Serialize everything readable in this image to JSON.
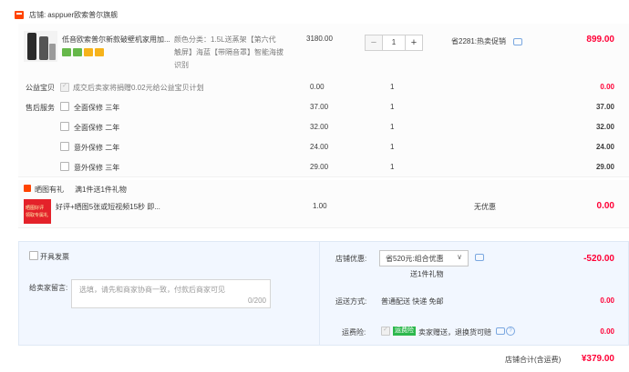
{
  "store": {
    "label": "店铺:",
    "name": "asppuer欧索普尔旗舰"
  },
  "product": {
    "title": "低音欧索普尔新款破壁机家用加...",
    "sku_lines": [
      "颜色分类：1.5L送蒸架【第六代",
      "触屏】海蓝【带隔音罩】智能海拔",
      "识别"
    ],
    "unit_price": "3180.00",
    "quantity": "1",
    "promo": "省2281:热卖促销",
    "total": "899.00",
    "minus": "−",
    "plus": "+",
    "badges": [
      {
        "color": "#66b84a",
        "icon": "seven-day-return-icon"
      },
      {
        "color": "#66b84a",
        "icon": "shopping-bag-icon"
      },
      {
        "color": "#f6b31b",
        "icon": "credit-card-icon"
      },
      {
        "color": "#f6b31b",
        "icon": "coupon-icon"
      }
    ]
  },
  "charity": {
    "label": "公益宝贝",
    "text": "成交后卖家将捐赠0.02元给公益宝贝计划",
    "price": "0.00",
    "qty": "1",
    "total": "0.00",
    "checked": true
  },
  "after_sales": {
    "label": "售后服务",
    "items": [
      {
        "name": "全面保修 三年",
        "price": "37.00",
        "qty": "1",
        "total": "37.00"
      },
      {
        "name": "全面保修 二年",
        "price": "32.00",
        "qty": "1",
        "total": "32.00"
      },
      {
        "name": "意外保修 二年",
        "price": "24.00",
        "qty": "1",
        "total": "24.00"
      },
      {
        "name": "意外保修 三年",
        "price": "29.00",
        "qty": "1",
        "total": "29.00"
      }
    ]
  },
  "gift": {
    "header_tag": "晒图有礼",
    "header_text": "满1件送1件礼物",
    "item_title": "好评+晒图5张或短视频15秒 即...",
    "price": "1.00",
    "discount": "无优惠",
    "total": "0.00",
    "img_lines": [
      "晒图好评",
      "领取专属礼"
    ]
  },
  "invoice": {
    "label": "开具发票"
  },
  "message": {
    "label": "给卖家留言:",
    "placeholder": "选填，请先和商家协商一致，付款后商家可见",
    "counter": "0/200"
  },
  "shop_discount": {
    "label": "店铺优惠:",
    "selected": "省520元:组合优惠",
    "caret": "∨",
    "sub": "送1件礼物",
    "amount": "-520.00"
  },
  "shipping": {
    "label": "运送方式:",
    "text": "普通配送 快递 免邮",
    "amount": "0.00"
  },
  "freight_insurance": {
    "label": "运费险:",
    "tag": "运费险",
    "text": "卖家赠送，退换货可赔",
    "amount": "0.00",
    "checked": true
  },
  "footer": {
    "label": "店铺合计(含运费)",
    "total": "¥379.00"
  },
  "colors": {
    "accent": "#ff0036",
    "brand": "#ff4400",
    "panel": "#f2f7ff",
    "freight_tag": "#2db84d"
  }
}
